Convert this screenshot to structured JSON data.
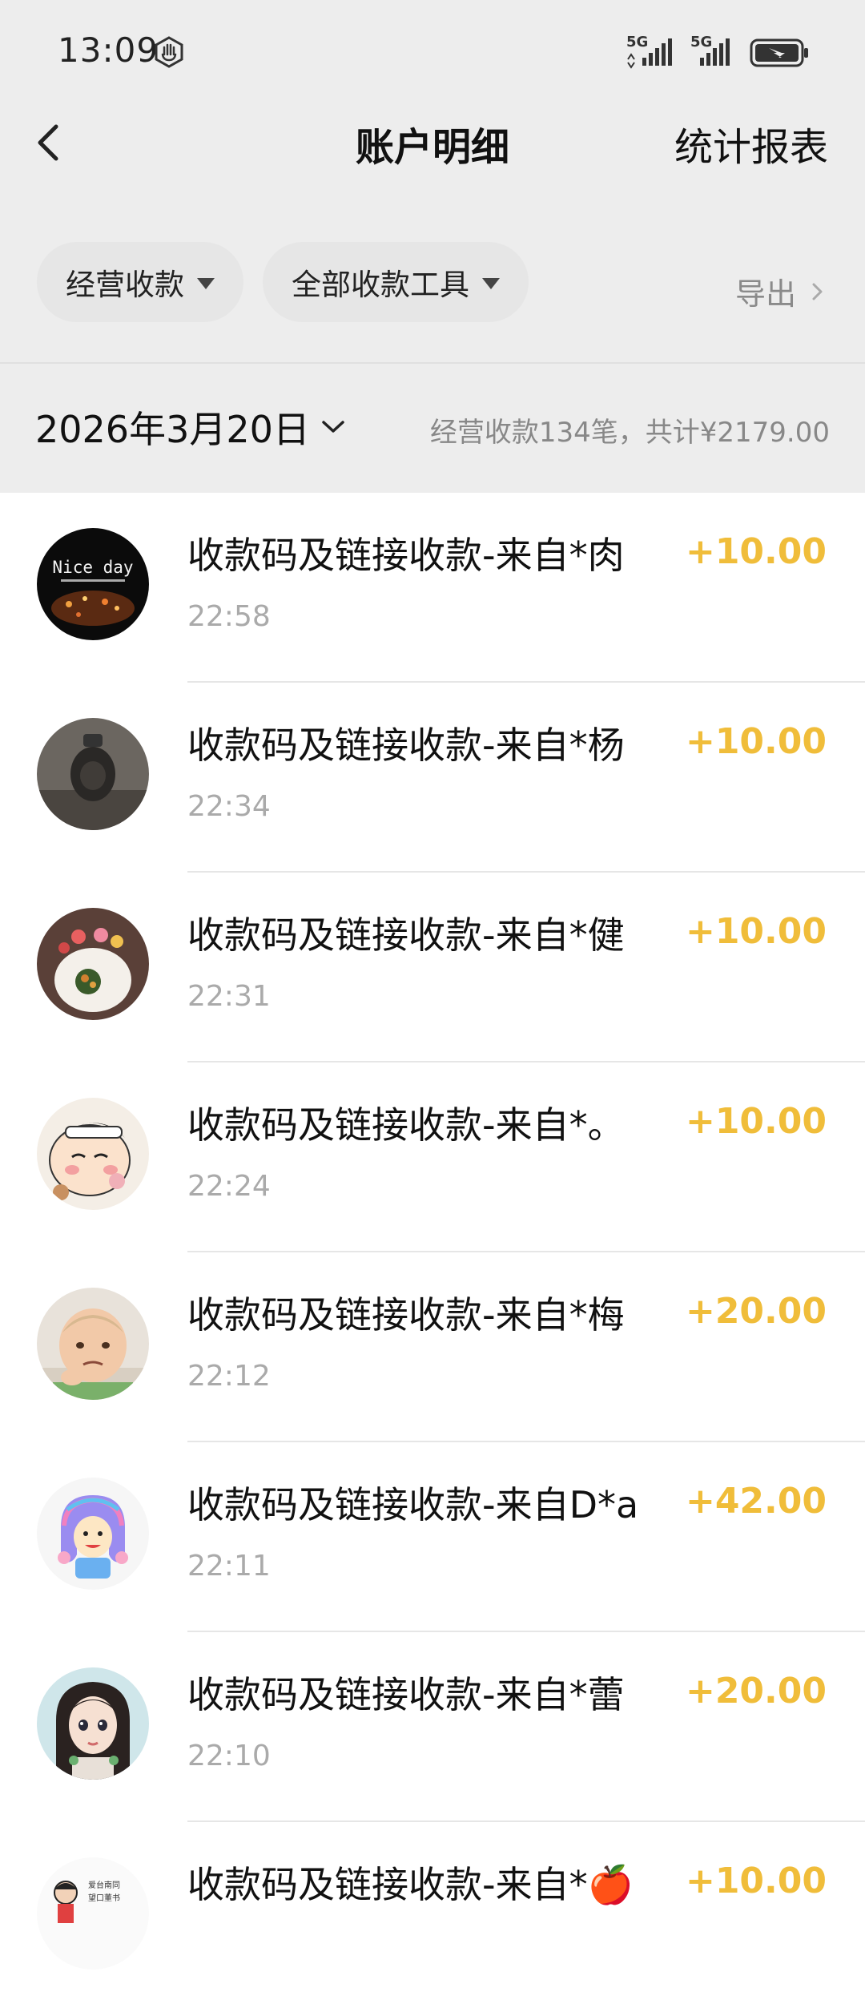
{
  "status_bar": {
    "time": "13:09",
    "network_1": "5G",
    "network_2": "5G"
  },
  "header": {
    "title": "账户明细",
    "report_label": "统计报表"
  },
  "filters": {
    "type_label": "经营收款",
    "tool_label": "全部收款工具",
    "export_label": "导出"
  },
  "date_bar": {
    "date": "2026年3月20日",
    "summary": "经营收款134笔，共计¥2179.00"
  },
  "colors": {
    "amount": "#f0bd3a",
    "header_bg": "#ededed"
  },
  "transactions": [
    {
      "title": "收款码及链接收款-来自*肉",
      "time": "22:58",
      "amount": "+10.00"
    },
    {
      "title": "收款码及链接收款-来自*杨",
      "time": "22:34",
      "amount": "+10.00"
    },
    {
      "title": "收款码及链接收款-来自*健",
      "time": "22:31",
      "amount": "+10.00"
    },
    {
      "title": "收款码及链接收款-来自*。",
      "time": "22:24",
      "amount": "+10.00"
    },
    {
      "title": "收款码及链接收款-来自*梅",
      "time": "22:12",
      "amount": "+20.00"
    },
    {
      "title": "收款码及链接收款-来自D*a",
      "time": "22:11",
      "amount": "+42.00"
    },
    {
      "title": "收款码及链接收款-来自*蕾",
      "time": "22:10",
      "amount": "+20.00"
    },
    {
      "title": "收款码及链接收款-来自*🍎",
      "time": "",
      "amount": "+10.00"
    }
  ],
  "avatars": {
    "0": {
      "text": "Nice day"
    },
    "7": {
      "text_1": "爱台南同",
      "text_2": "望口董书"
    }
  }
}
